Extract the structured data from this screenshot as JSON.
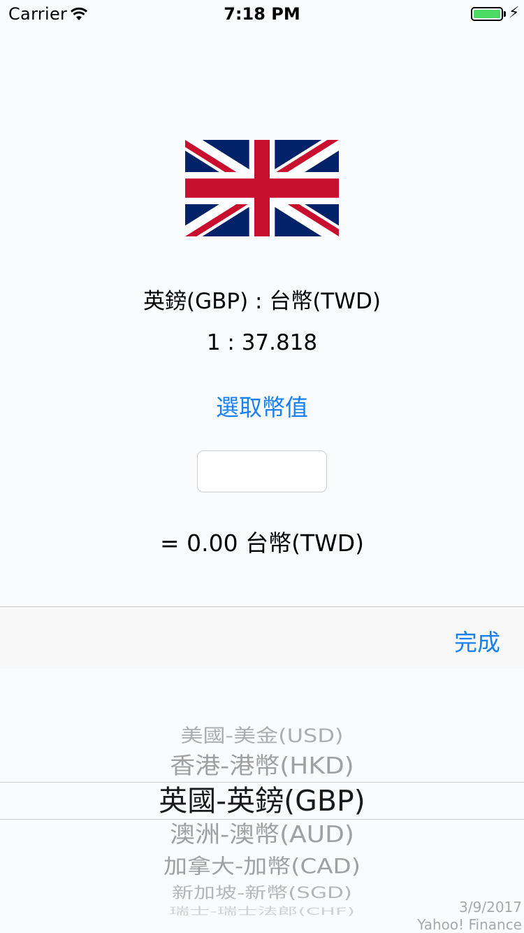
{
  "status_bar": {
    "carrier": "Carrier",
    "time": "7:18 PM",
    "bolt": "⚡"
  },
  "colors": {
    "accent": "#1780f4",
    "battery": "#4cd964",
    "flag_blue": "#012169",
    "flag_red": "#C8102E"
  },
  "converter": {
    "flag_icon": "uk-flag",
    "pair_label": "英鎊(GBP) : 台幣(TWD)",
    "rate_label": "1 : 37.818",
    "select_button_label": "選取幣值",
    "amount_value": "",
    "result_label": "= 0.00 台幣(TWD)"
  },
  "toolbar": {
    "done_label": "完成"
  },
  "picker": {
    "items": [
      "美國-美金(USD)",
      "香港-港幣(HKD)",
      "英國-英鎊(GBP)",
      "澳洲-澳幣(AUD)",
      "加拿大-加幣(CAD)",
      "新加坡-新幣(SGD)",
      "瑞士-瑞士法郎(CHF)"
    ],
    "selected_index": 2
  },
  "footer": {
    "date": "3/9/2017",
    "source": "Yahoo! Finance"
  }
}
